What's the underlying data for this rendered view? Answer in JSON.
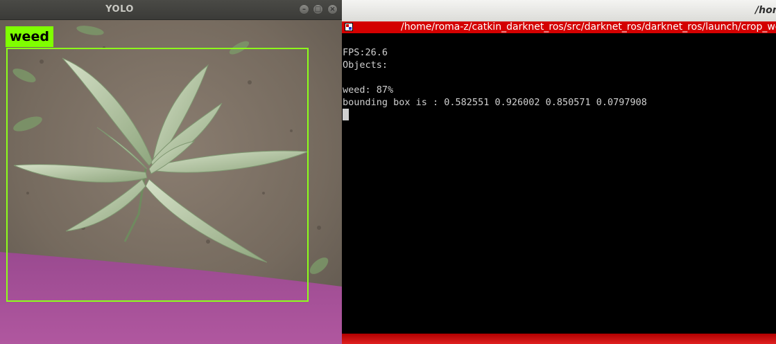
{
  "yolo_window": {
    "title": "YOLO",
    "buttons": {
      "minimize": "",
      "maximize": "",
      "close": "×"
    },
    "detection": {
      "label": "weed",
      "box_color": "#8dff1a",
      "label_bg": "#7fff00"
    }
  },
  "terminal": {
    "title": "/hom",
    "tab_title": "/home/roma-z/catkin_darknet_ros/src/darknet_ros/darknet_ros/launch/crop_we",
    "lines": {
      "fps": "FPS:26.6",
      "objects": "Objects:",
      "blank": "",
      "detection": "weed: 87%",
      "bbox": "bounding box is : 0.582551 0.926002 0.850571 0.0797908"
    },
    "accent_color": "#d40000"
  }
}
